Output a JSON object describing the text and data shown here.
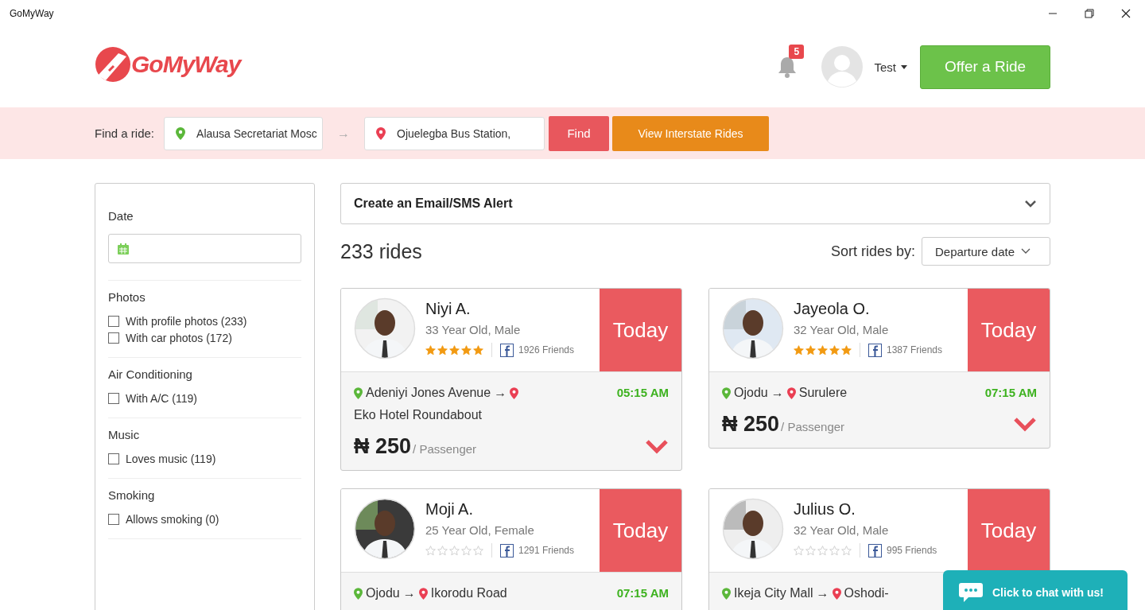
{
  "window": {
    "title": "GoMyWay"
  },
  "header": {
    "logo": "GoMyWay",
    "notifications": "5",
    "user": "Test",
    "offer_button": "Offer a Ride"
  },
  "search": {
    "label": "Find a ride:",
    "from": "Alausa Secretariat Mosc",
    "arrow": "→",
    "to": "Ojuelegba Bus Station,",
    "find_button": "Find",
    "interstate_button": "View Interstate Rides"
  },
  "filters": [
    {
      "kind": "date",
      "title": "Date"
    },
    {
      "kind": "checks",
      "title": "Photos",
      "options": [
        {
          "label": "With profile photos (233)",
          "checked": false
        },
        {
          "label": "With car photos (172)",
          "checked": false
        }
      ]
    },
    {
      "kind": "checks",
      "title": "Air Conditioning",
      "options": [
        {
          "label": "With A/C (119)",
          "checked": false
        }
      ]
    },
    {
      "kind": "checks",
      "title": "Music",
      "options": [
        {
          "label": "Loves music (119)",
          "checked": false
        }
      ]
    },
    {
      "kind": "checks",
      "title": "Smoking",
      "options": [
        {
          "label": "Allows smoking (0)",
          "checked": false
        }
      ]
    }
  ],
  "alert": {
    "title": "Create an Email/SMS Alert"
  },
  "results": {
    "count": "233 rides",
    "sort_label": "Sort rides by:",
    "sort_value": "Departure date"
  },
  "rides": [
    {
      "name": "Niyi A.",
      "details": "33 Year Old, Male",
      "stars": 5,
      "friends": "1926 Friends",
      "day": "Today",
      "from": "Adeniyi Jones Avenue",
      "arrow": "→",
      "to": "Eko Hotel Roundabout",
      "time": "05:15 AM",
      "currency": "₦",
      "price": "250",
      "unit": "/ Passenger"
    },
    {
      "name": "Jayeola O.",
      "details": "32 Year Old, Male",
      "stars": 5,
      "friends": "1387 Friends",
      "day": "Today",
      "from": "Ojodu",
      "arrow": "→",
      "to": "Surulere",
      "time": "07:15 AM",
      "currency": "₦",
      "price": "250",
      "unit": "/ Passenger"
    },
    {
      "name": "Moji A.",
      "details": "25 Year Old, Female",
      "stars": 0,
      "friends": "1291 Friends",
      "day": "Today",
      "from": "Ojodu",
      "arrow": "→",
      "to": "Ikorodu Road",
      "time": "07:15 AM"
    },
    {
      "name": "Julius O.",
      "details": "32 Year Old, Male",
      "stars": 0,
      "friends": "995 Friends",
      "day": "Today",
      "from": "Ikeja City Mall",
      "arrow": "→",
      "to": "Oshodi-"
    }
  ],
  "chat": {
    "label": "Click to chat with us!"
  }
}
